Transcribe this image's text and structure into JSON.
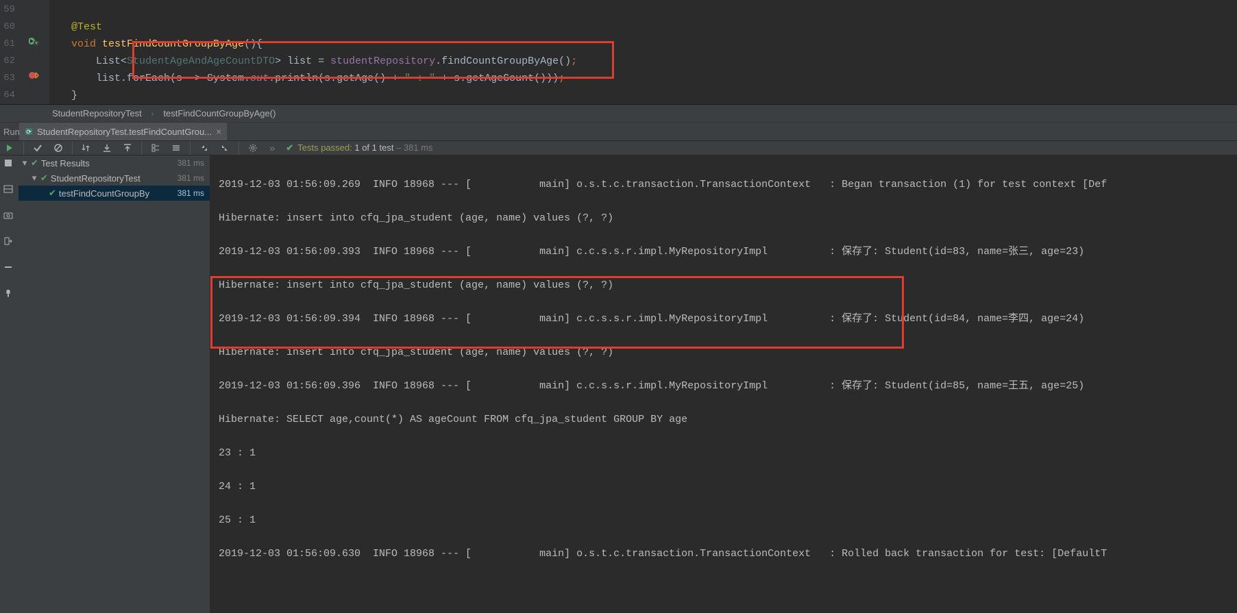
{
  "editor": {
    "lines": [
      "59",
      "60",
      "61",
      "62",
      "63",
      "64"
    ],
    "code": {
      "l60": {
        "annotation": "@Test"
      },
      "l61": {
        "kw1": "void",
        "fname": "testFindCountGroupByAge",
        "parens": "(){"
      },
      "l62": {
        "pre": "List",
        "type_open": "<",
        "type": "StudentAgeAndAgeCountDTO",
        "type_close": ">",
        "var": " list = ",
        "field": "studentRepository",
        "call": ".findCountGroupByAge()",
        "semi": ";"
      },
      "l63": {
        "pre": "list.forEach(s -> System.",
        "out": "out",
        "mid": ".println(s.getAge() + ",
        "str1": "\" : \"",
        "mid2": " + s.getAgeCount()))",
        "semi": ";"
      },
      "l64": {
        "brace": "}"
      }
    }
  },
  "breadcrumb": {
    "a": "StudentRepositoryTest",
    "b": "testFindCountGroupByAge()"
  },
  "runtab": {
    "label": "Run:",
    "title": "StudentRepositoryTest.testFindCountGrou..."
  },
  "toolbar": {
    "arrows": "»",
    "status_prefix": "Tests passed:",
    "status_count": " 1 of 1 test",
    "status_time": " – 381 ms"
  },
  "tree": {
    "root": "Test Results",
    "root_time": "381 ms",
    "child1": "StudentRepositoryTest",
    "child1_time": "381 ms",
    "child2": "testFindCountGroupBy",
    "child2_time": "381 ms"
  },
  "console_lines": [
    "2019-12-03 01:56:09.269  INFO 18968 --- [           main] o.s.t.c.transaction.TransactionContext   : Began transaction (1) for test context [Def",
    "Hibernate: insert into cfq_jpa_student (age, name) values (?, ?)",
    "2019-12-03 01:56:09.393  INFO 18968 --- [           main] c.c.s.s.r.impl.MyRepositoryImpl          : 保存了: Student(id=83, name=张三, age=23)",
    "Hibernate: insert into cfq_jpa_student (age, name) values (?, ?)",
    "2019-12-03 01:56:09.394  INFO 18968 --- [           main] c.c.s.s.r.impl.MyRepositoryImpl          : 保存了: Student(id=84, name=李四, age=24)",
    "Hibernate: insert into cfq_jpa_student (age, name) values (?, ?)",
    "2019-12-03 01:56:09.396  INFO 18968 --- [           main] c.c.s.s.r.impl.MyRepositoryImpl          : 保存了: Student(id=85, name=王五, age=25)",
    "Hibernate: SELECT age,count(*) AS ageCount FROM cfq_jpa_student GROUP BY age",
    "23 : 1",
    "24 : 1",
    "25 : 1",
    "2019-12-03 01:56:09.630  INFO 18968 --- [           main] o.s.t.c.transaction.TransactionContext   : Rolled back transaction for test: [DefaultT"
  ]
}
